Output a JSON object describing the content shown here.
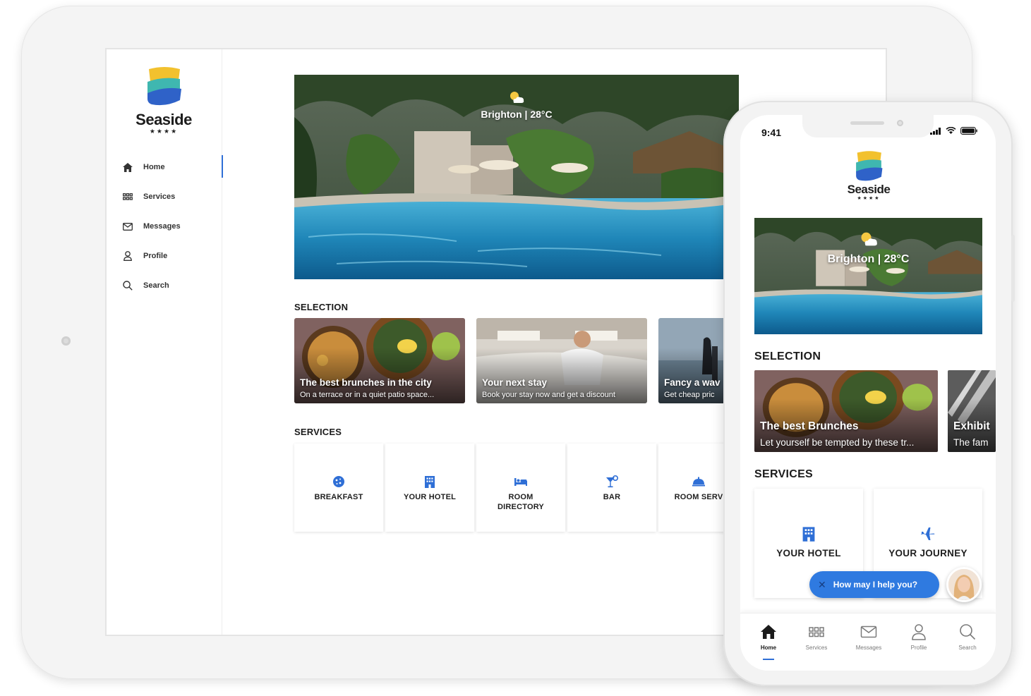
{
  "brand": {
    "name": "Seaside",
    "stars": "★★★★",
    "accent": "#2f6fd6"
  },
  "tablet": {
    "nav": [
      {
        "label": "Home",
        "icon": "home-icon",
        "active": true
      },
      {
        "label": "Services",
        "icon": "grid-icon"
      },
      {
        "label": "Messages",
        "icon": "mail-icon"
      },
      {
        "label": "Profile",
        "icon": "user-icon"
      },
      {
        "label": "Search",
        "icon": "search-icon"
      }
    ],
    "hero": {
      "weather": "Brighton | 28°C",
      "weather_icon": "partly-cloudy-icon"
    },
    "selection_title": "SELECTION",
    "cards": [
      {
        "title": "The best brunches in the city",
        "subtitle": "On a terrace or in a quiet patio space..."
      },
      {
        "title": "Your next stay",
        "subtitle": "Book your stay now and get a discount"
      },
      {
        "title": "Fancy a wav",
        "subtitle": "Get cheap pric"
      }
    ],
    "services_title": "SERVICES",
    "services": [
      {
        "label": "BREAKFAST",
        "icon": "cookie-icon"
      },
      {
        "label": "YOUR HOTEL",
        "icon": "hotel-icon"
      },
      {
        "label": "ROOM DIRECTORY",
        "icon": "bed-icon"
      },
      {
        "label": "BAR",
        "icon": "cocktail-icon"
      },
      {
        "label": "ROOM SERV",
        "icon": "cloche-icon"
      }
    ]
  },
  "phone": {
    "time": "9:41",
    "hero": {
      "weather": "Brighton | 28°C"
    },
    "selection_title": "SELECTION",
    "cards": [
      {
        "title": "The best Brunches",
        "subtitle": "Let yourself be tempted by these tr..."
      },
      {
        "title": "Exhibit",
        "subtitle": "The fam"
      }
    ],
    "services_title": "SERVICES",
    "services": [
      {
        "label": "YOUR HOTEL",
        "icon": "hotel-icon"
      },
      {
        "label": "YOUR JOURNEY",
        "icon": "plane-icon"
      }
    ],
    "chat": {
      "label": "How may I help you?",
      "close": "✕"
    },
    "tabs": [
      {
        "label": "Home",
        "icon": "home-icon",
        "active": true
      },
      {
        "label": "Services",
        "icon": "grid-icon"
      },
      {
        "label": "Messages",
        "icon": "mail-icon"
      },
      {
        "label": "Profile",
        "icon": "user-icon"
      },
      {
        "label": "Search",
        "icon": "search-icon"
      }
    ]
  }
}
